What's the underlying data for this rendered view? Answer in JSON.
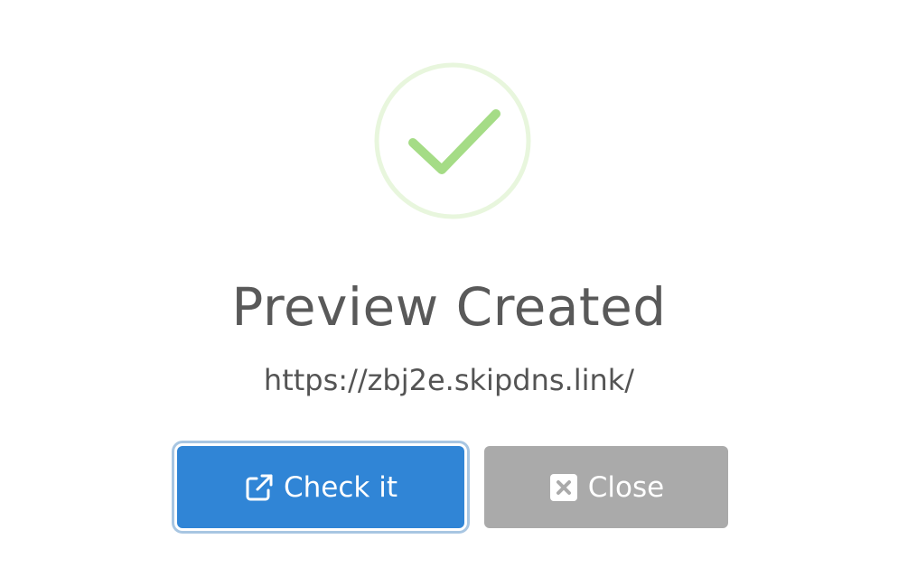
{
  "dialog": {
    "icon": "success-check-icon",
    "title": "Preview Created",
    "url": "https://zbj2e.skipdns.link/",
    "buttons": {
      "check_label": "Check it",
      "check_icon": "external-link-icon",
      "close_label": "Close",
      "close_icon": "close-square-icon"
    },
    "colors": {
      "success_ring": "#e7f5dc",
      "success_check": "#a5dc86",
      "confirm": "#3085d6",
      "cancel": "#aaaaaa",
      "title_text": "#595959"
    }
  }
}
